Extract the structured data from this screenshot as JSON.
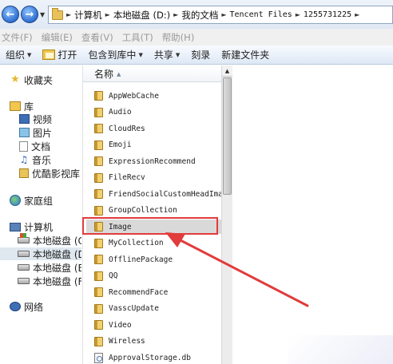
{
  "address": {
    "crumbs": [
      "计算机",
      "本地磁盘 (D:)",
      "我的文档",
      "Tencent Files",
      "1255731225"
    ]
  },
  "menu": [
    "文件(F)",
    "编辑(E)",
    "查看(V)",
    "工具(T)",
    "帮助(H)"
  ],
  "toolbar": {
    "organize": "组织",
    "open": "打开",
    "include_library": "包含到库中",
    "share": "共享",
    "burn": "刻录",
    "new_folder": "新建文件夹"
  },
  "nav": {
    "favorites": "收藏夹",
    "libraries": "库",
    "lib_items": [
      "视频",
      "图片",
      "文档",
      "音乐",
      "优酷影视库"
    ],
    "homegroup": "家庭组",
    "computer": "计算机",
    "drives": [
      "本地磁盘 (C",
      "本地磁盘 (D",
      "本地磁盘 (E",
      "本地磁盘 (F"
    ],
    "network": "网络"
  },
  "file_list": {
    "column_name": "名称",
    "items": [
      {
        "name": "AppWebCache",
        "type": "folder"
      },
      {
        "name": "Audio",
        "type": "folder"
      },
      {
        "name": "CloudRes",
        "type": "folder"
      },
      {
        "name": "Emoji",
        "type": "folder"
      },
      {
        "name": "ExpressionRecommend",
        "type": "folder"
      },
      {
        "name": "FileRecv",
        "type": "folder"
      },
      {
        "name": "FriendSocialCustomHeadIma",
        "type": "folder"
      },
      {
        "name": "GroupCollection",
        "type": "folder"
      },
      {
        "name": "Image",
        "type": "folder"
      },
      {
        "name": "MyCollection",
        "type": "folder"
      },
      {
        "name": "OfflinePackage",
        "type": "folder"
      },
      {
        "name": "QQ",
        "type": "folder"
      },
      {
        "name": "RecommendFace",
        "type": "folder"
      },
      {
        "name": "VasscUpdate",
        "type": "folder"
      },
      {
        "name": "Video",
        "type": "folder"
      },
      {
        "name": "Wireless",
        "type": "folder"
      },
      {
        "name": "ApprovalStorage.db",
        "type": "db"
      }
    ],
    "selected_index": 8
  },
  "colors": {
    "annotation_red": "#e23b3b",
    "selection_gray": "#d9d9d9"
  }
}
